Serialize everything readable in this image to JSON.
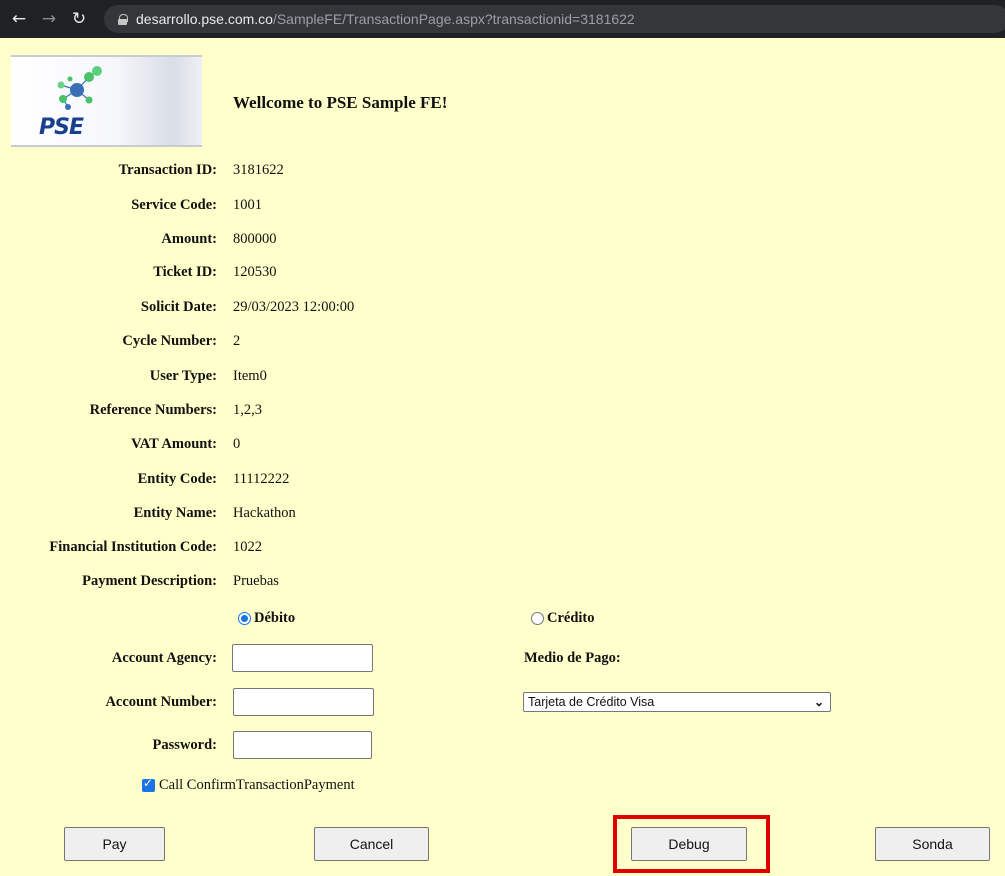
{
  "browser": {
    "url_host": "desarrollo.pse.com.co",
    "url_path": "/SampleFE/TransactionPage.aspx?transactionid=3181622"
  },
  "logo": {
    "text": "PSE"
  },
  "welcome": "Wellcome to PSE Sample FE!",
  "fields": [
    {
      "label": "Transaction ID:",
      "value": "3181622"
    },
    {
      "label": "Service Code:",
      "value": "1001"
    },
    {
      "label": "Amount:",
      "value": "800000"
    },
    {
      "label": "Ticket ID:",
      "value": "120530"
    },
    {
      "label": "Solicit Date:",
      "value": "29/03/2023 12:00:00"
    },
    {
      "label": "Cycle Number:",
      "value": "2"
    },
    {
      "label": "User Type:",
      "value": "Item0"
    },
    {
      "label": "Reference Numbers:",
      "value": "1,2,3"
    },
    {
      "label": "VAT Amount:",
      "value": "0"
    },
    {
      "label": "Entity Code:",
      "value": "11112222"
    },
    {
      "label": "Entity Name:",
      "value": "Hackathon"
    },
    {
      "label": "Financial Institution Code:",
      "value": "1022"
    },
    {
      "label": "Payment Description:",
      "value": "Pruebas"
    }
  ],
  "payment": {
    "debito_label": "Débito",
    "credito_label": "Crédito",
    "account_agency_label": "Account Agency:",
    "account_number_label": "Account Number:",
    "password_label": "Password:",
    "medio_label": "Medio de Pago:",
    "medio_selected": "Tarjeta de Crédito Visa",
    "confirm_label": "Call ConfirmTransactionPayment"
  },
  "buttons": {
    "pay": "Pay",
    "cancel": "Cancel",
    "debug": "Debug",
    "sonda": "Sonda"
  },
  "colors": {
    "page_background": "#ffffcc",
    "highlight": "#e00000",
    "accent": "#1a73e8"
  }
}
